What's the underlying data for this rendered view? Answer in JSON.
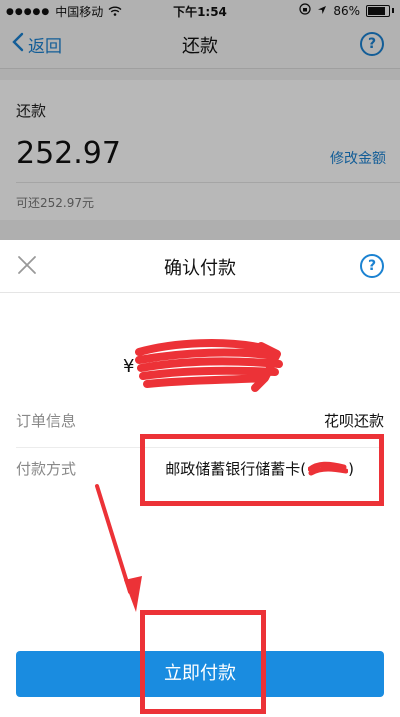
{
  "status_bar": {
    "carrier": "中国移动",
    "time": "下午1:54",
    "battery": "86%"
  },
  "nav": {
    "back_label": "返回",
    "title": "还款",
    "help": "?"
  },
  "repay": {
    "label": "还款",
    "amount": "252.97",
    "modify_label": "修改金额",
    "repayable": "可还252.97元"
  },
  "sheet": {
    "title": "确认付款",
    "help": "?",
    "currency": "¥",
    "order_label": "订单信息",
    "order_value": "花呗还款",
    "method_label": "付款方式",
    "method_value": "邮政储蓄银行储蓄卡(",
    "method_suffix": ")",
    "pay_button": "立即付款"
  },
  "colors": {
    "accent": "#1b82d1",
    "pay_button": "#1a8ce0",
    "annotation_red": "#ec3237"
  },
  "icons": {
    "back": "chevron-left-icon",
    "help": "help-circle-icon",
    "close": "close-icon",
    "wifi": "wifi-icon",
    "location": "location-icon"
  }
}
